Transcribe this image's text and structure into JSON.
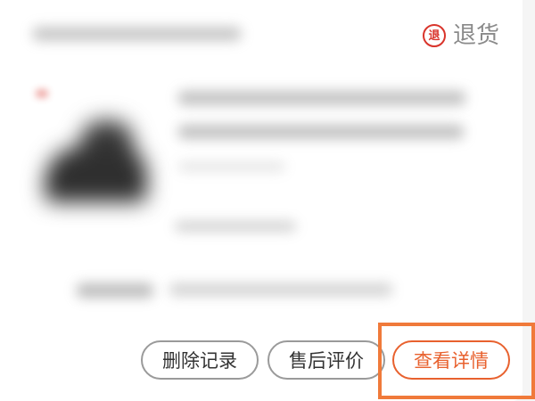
{
  "header": {
    "return_icon_glyph": "退",
    "return_label": "退货",
    "return_icon": "return-badge-icon"
  },
  "actions": {
    "delete_record": "删除记录",
    "after_sales_review": "售后评价",
    "view_details": "查看详情"
  },
  "colors": {
    "accent": "#e8612e",
    "highlight": "#f07a3a",
    "return_red": "#d9342b"
  }
}
